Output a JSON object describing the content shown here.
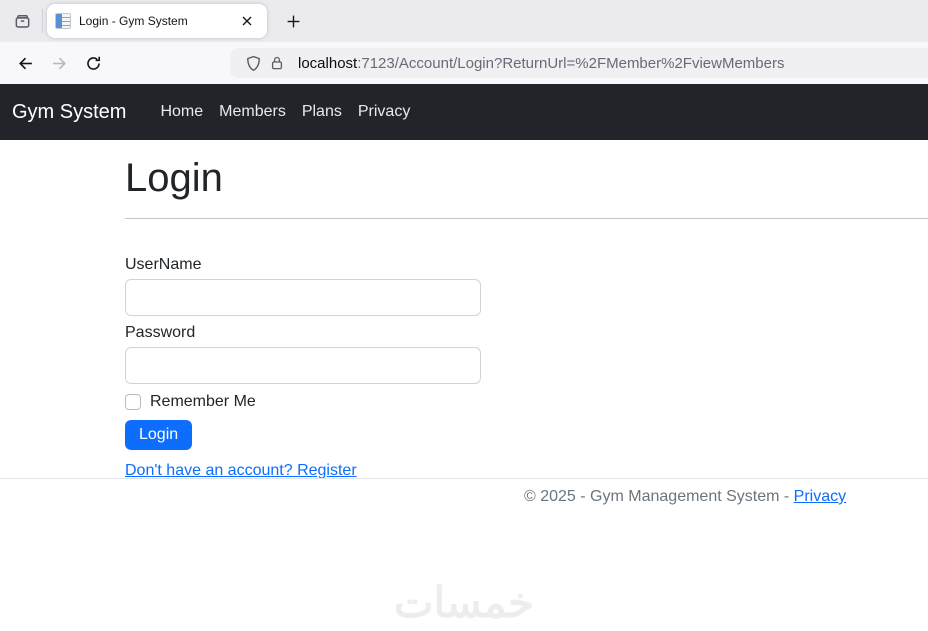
{
  "browser": {
    "tab_title": "Login - Gym System",
    "url_host": "localhost",
    "url_rest": ":7123/Account/Login?ReturnUrl=%2FMember%2FviewMembers"
  },
  "navbar": {
    "brand": "Gym System",
    "links": [
      "Home",
      "Members",
      "Plans",
      "Privacy"
    ]
  },
  "page": {
    "title": "Login",
    "form": {
      "username_label": "UserName",
      "username_value": "",
      "password_label": "Password",
      "password_value": "",
      "remember_label": "Remember Me",
      "login_button": "Login",
      "register_link": "Don't have an account? Register"
    }
  },
  "footer": {
    "copyright": "© 2025 - Gym Management System -",
    "privacy_link": "Privacy"
  },
  "watermark": "خمسات",
  "colors": {
    "accent": "#0d6efd",
    "navbar_bg": "#212529",
    "muted_text": "#6c757d"
  }
}
